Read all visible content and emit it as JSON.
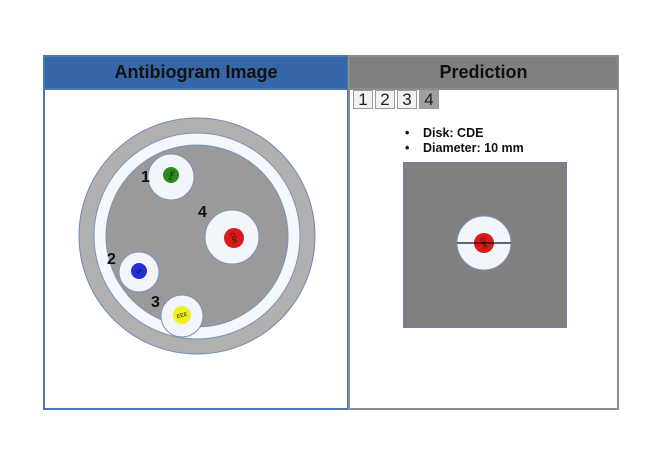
{
  "left_panel": {
    "title": "Antibiogram Image",
    "disks": [
      {
        "number": "1",
        "label": "AMC",
        "color": "#2e8b1f"
      },
      {
        "number": "2",
        "label": "VA",
        "color": "#1f2fd8"
      },
      {
        "number": "3",
        "label": "EEE",
        "color": "#eef020"
      },
      {
        "number": "4",
        "label": "CDE",
        "color": "#d81a1a"
      }
    ]
  },
  "right_panel": {
    "title": "Prediction",
    "tabs": [
      "1",
      "2",
      "3",
      "4"
    ],
    "active_tab": "4",
    "disk_line": "Disk: CDE",
    "diameter_line": "Diameter: 10 mm",
    "predicted_disk": {
      "label": "CDE",
      "color": "#d81a1a"
    }
  }
}
